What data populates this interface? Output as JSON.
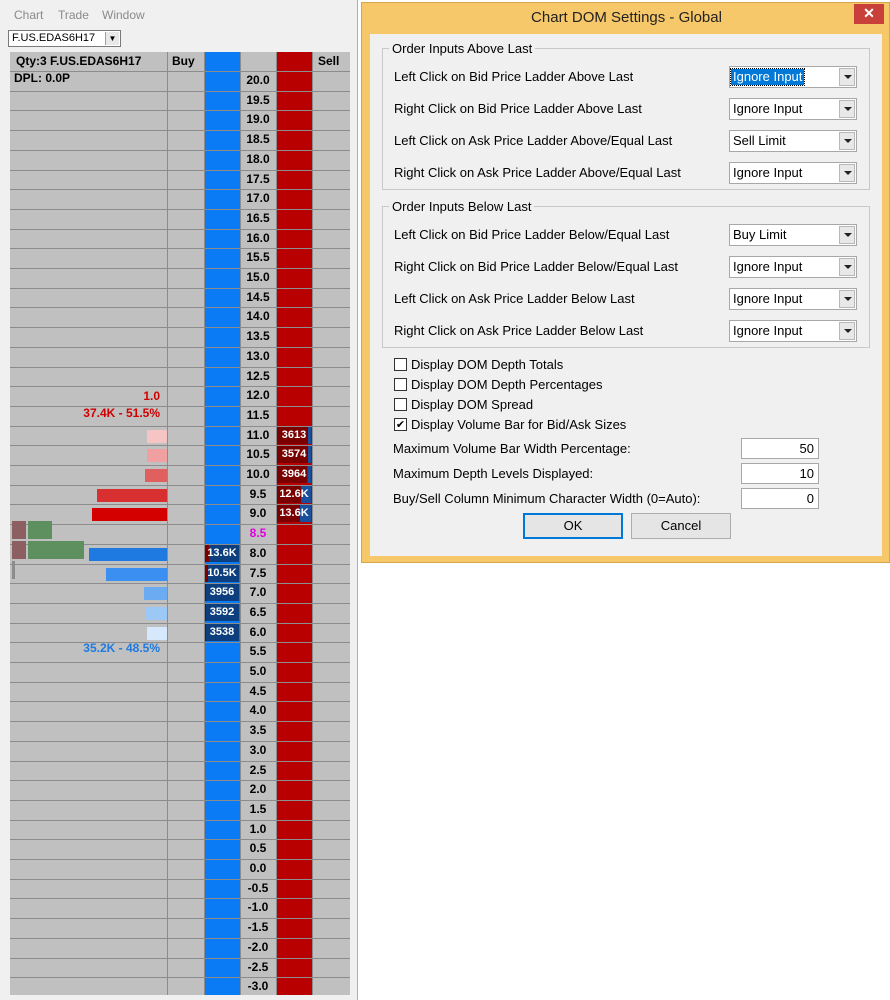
{
  "menu": [
    "Chart",
    "Trade",
    "Window"
  ],
  "symbol": "F.US.EDAS6H17",
  "ladder": {
    "header_qty": "Qty:3 F.US.EDAS6H17",
    "header_dpl": "DPL: 0.0P",
    "buy_label": "Buy",
    "sell_label": "Sell",
    "prices": [
      "20.0",
      "19.5",
      "19.0",
      "18.5",
      "18.0",
      "17.5",
      "17.0",
      "16.5",
      "16.0",
      "15.5",
      "15.0",
      "14.5",
      "14.0",
      "13.5",
      "13.0",
      "12.5",
      "12.0",
      "11.5",
      "11.0",
      "10.5",
      "10.0",
      "9.5",
      "9.0",
      "8.5",
      "8.0",
      "7.5",
      "7.0",
      "6.5",
      "6.0",
      "5.5",
      "5.0",
      "4.5",
      "4.0",
      "3.5",
      "3.0",
      "2.5",
      "2.0",
      "1.5",
      "1.0",
      "0.5",
      "0.0",
      "-0.5",
      "-1.0",
      "-1.5",
      "-2.0",
      "-2.5",
      "-3.0"
    ],
    "last_price": "8.5",
    "ask_sizes": [
      {
        "price": "11.0",
        "size": "3613",
        "fill": 0.22
      },
      {
        "price": "10.5",
        "size": "3574",
        "fill": 0.22
      },
      {
        "price": "10.0",
        "size": "3964",
        "fill": 0.24
      },
      {
        "price": "9.5",
        "size": "12.6K",
        "fill": 0.76
      },
      {
        "price": "9.0",
        "size": "13.6K",
        "fill": 0.82
      }
    ],
    "bid_sizes": [
      {
        "price": "8.0",
        "size": "13.6K",
        "fill": 1.0
      },
      {
        "price": "7.5",
        "size": "10.5K",
        "fill": 0.78
      },
      {
        "price": "7.0",
        "size": "3956",
        "fill": 0.29
      },
      {
        "price": "6.5",
        "size": "3592",
        "fill": 0.27
      },
      {
        "price": "6.0",
        "size": "3538",
        "fill": 0.26
      }
    ],
    "ask_total_qty": "1.0",
    "ask_total": "37.4K - 51.5%",
    "bid_total": "35.2K - 48.5%"
  },
  "dialog": {
    "title": "Chart DOM Settings - Global",
    "close_glyph": "✕",
    "group_above_title": "Order Inputs Above Last",
    "group_below_title": "Order Inputs Below Last",
    "above": [
      {
        "label": "Left Click on Bid Price Ladder Above Last",
        "value": "Ignore Input",
        "selected": true
      },
      {
        "label": "Right Click on Bid Price Ladder Above Last",
        "value": "Ignore Input"
      },
      {
        "label": "Left Click on Ask Price Ladder Above/Equal Last",
        "value": "Sell Limit"
      },
      {
        "label": "Right Click on Ask Price Ladder Above/Equal Last",
        "value": "Ignore Input"
      }
    ],
    "below": [
      {
        "label": "Left Click on Bid Price Ladder Below/Equal Last",
        "value": "Buy Limit"
      },
      {
        "label": "Right Click on Bid Price Ladder Below/Equal Last",
        "value": "Ignore Input"
      },
      {
        "label": "Left Click on Ask Price Ladder Below Last",
        "value": "Ignore Input"
      },
      {
        "label": "Right Click on Ask Price Ladder Below Last",
        "value": "Ignore Input"
      }
    ],
    "checkboxes": [
      {
        "label": "Display DOM Depth Totals",
        "checked": false
      },
      {
        "label": "Display DOM Depth Percentages",
        "checked": false
      },
      {
        "label": "Display DOM Spread",
        "checked": false
      },
      {
        "label": "Display Volume Bar for Bid/Ask Sizes",
        "checked": true
      }
    ],
    "fields": [
      {
        "label": "Maximum Volume Bar Width Percentage:",
        "value": "50"
      },
      {
        "label": "Maximum Depth Levels Displayed:",
        "value": "10"
      },
      {
        "label": "Buy/Sell Column Minimum Character Width (0=Auto):",
        "value": "0"
      }
    ],
    "ok_label": "OK",
    "cancel_label": "Cancel",
    "check_glyph": "✔"
  },
  "colors": {
    "bid": "#0a7af5",
    "ask": "#b90000",
    "dialog_frame": "#f7c86a",
    "last_price": "#e000e0"
  }
}
